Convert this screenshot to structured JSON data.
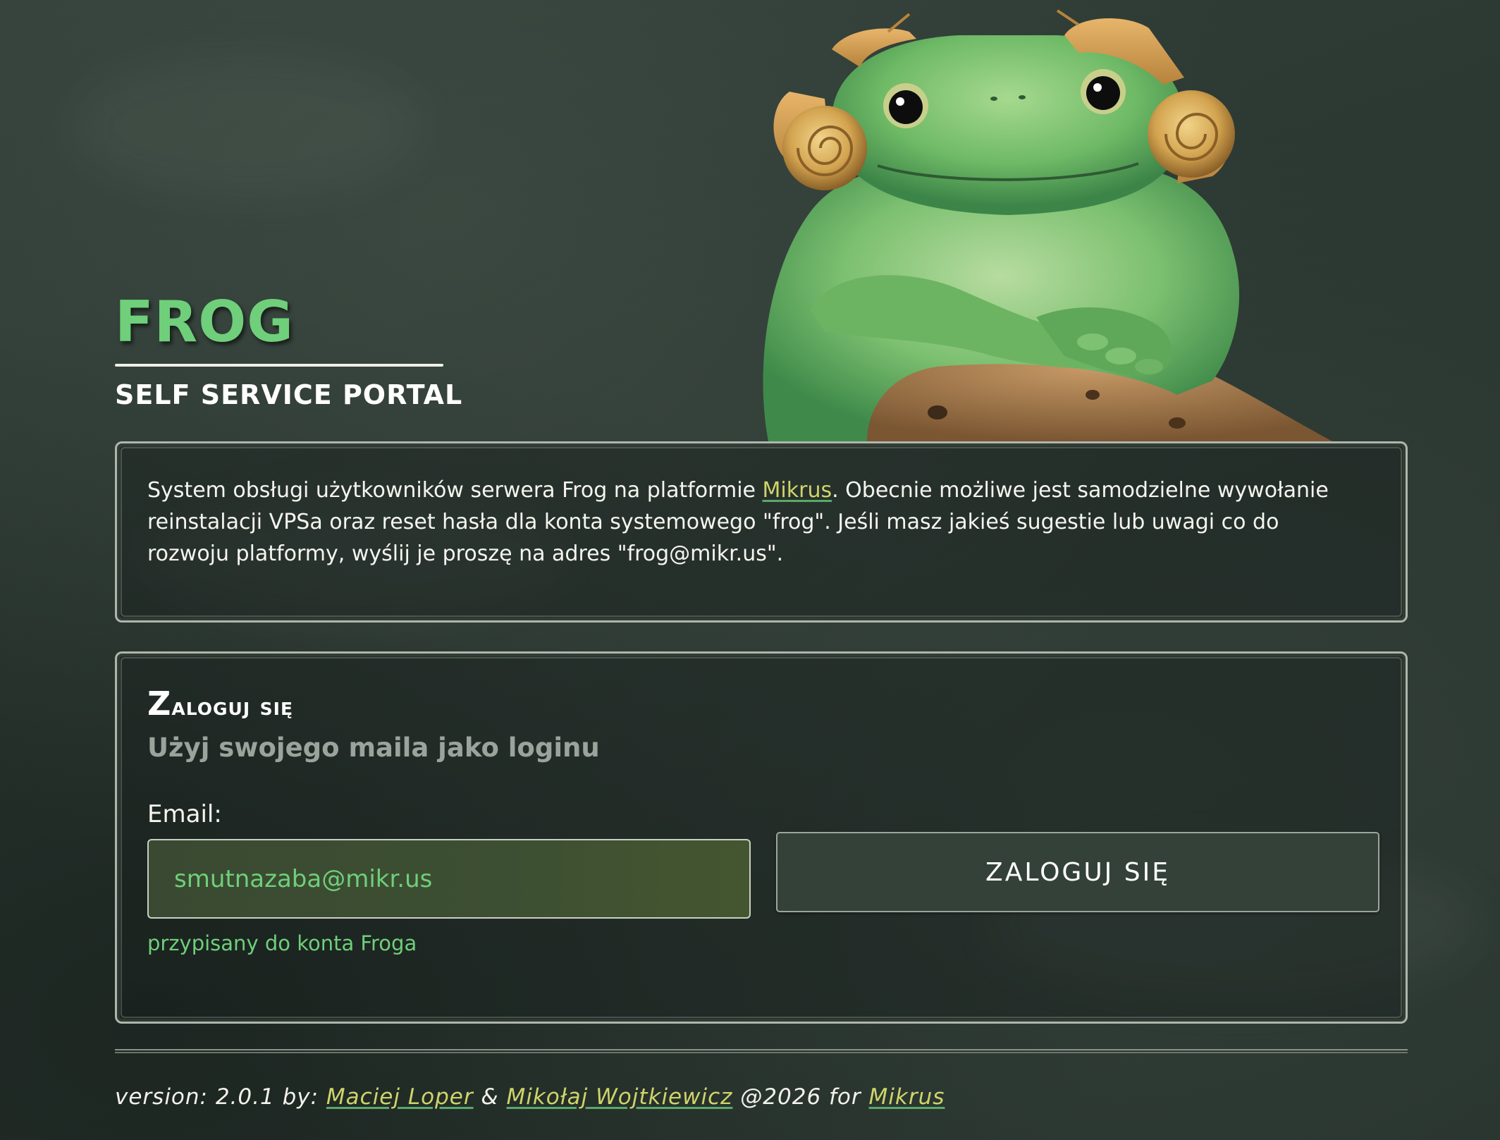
{
  "header": {
    "title": "FROG",
    "subtitle": "SELF SERVICE PORTAL"
  },
  "info": {
    "text_before_link": "System obsługi użytkowników serwera Frog na platformie ",
    "link_label": "Mikrus",
    "text_after_link": ". Obecnie możliwe jest samodzielne wywołanie reinstalacji VPSa oraz reset hasła dla konta systemowego \"frog\". Jeśli masz jakieś sugestie lub uwagi co do rozwoju platformy, wyślij je proszę na adres \"frog@mikr.us\"."
  },
  "login": {
    "title_first": "Z",
    "title_rest": "aloguj się",
    "subtitle": "Użyj swojego maila jako loginu",
    "email_label": "Email:",
    "email_value": "smutnazaba@mikr.us",
    "helper": "przypisany do konta Froga",
    "button_label": "ZALOGUJ SIĘ"
  },
  "footer": {
    "prefix": "version: 2.0.1 by: ",
    "author1": "Maciej Loper",
    "amp": " & ",
    "author2": "Mikołaj Wojtkiewicz",
    "year_for": " @2026 for ",
    "brand_link": "Mikrus"
  },
  "colors": {
    "accent_green": "#6fcf7a",
    "link_yellow": "#cfd46a",
    "background": "#2b3731"
  },
  "icons": {
    "hero": "frog-illustration"
  }
}
